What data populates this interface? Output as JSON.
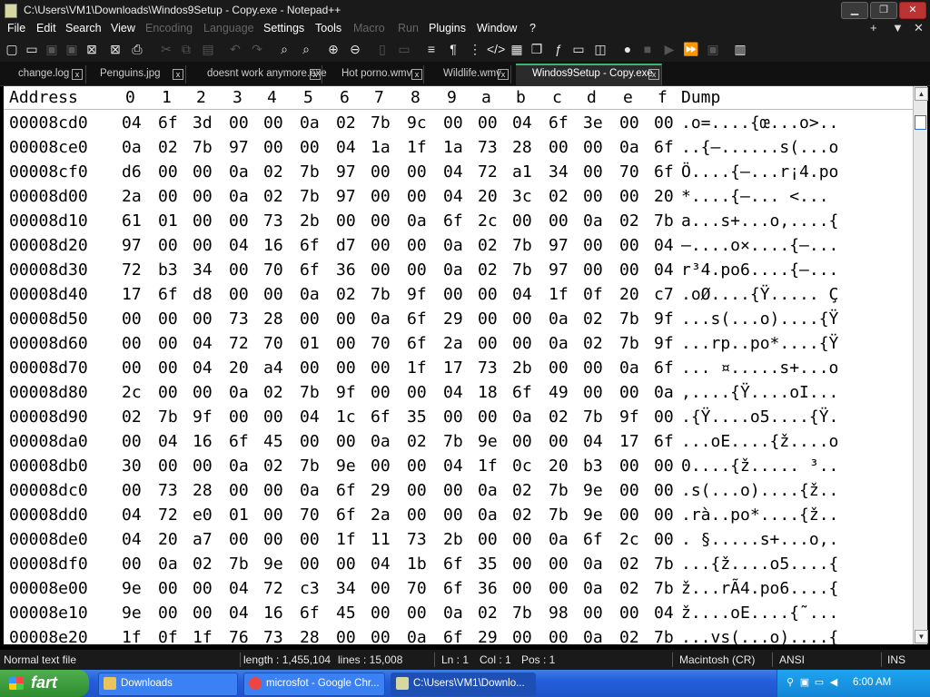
{
  "window": {
    "title": "C:\\Users\\VM1\\Downloads\\Windos9Setup - Copy.exe - Notepad++",
    "minimize": "▁",
    "maximize": "❐",
    "close": "✕"
  },
  "menu": {
    "items": [
      "File",
      "Edit",
      "Search",
      "View",
      "Encoding",
      "Language",
      "Settings",
      "Tools",
      "Macro",
      "Run",
      "Plugins",
      "Window",
      "?"
    ],
    "right_buttons": [
      "+",
      "▼",
      "✕"
    ]
  },
  "toolbar": {
    "icons": [
      "new-file-icon",
      "open-file-icon",
      "save-icon",
      "save-all-icon",
      "close-icon",
      "close-all-icon",
      "print-icon",
      "cut-icon",
      "copy-icon",
      "paste-icon",
      "undo-icon",
      "redo-icon",
      "find-icon",
      "replace-icon",
      "zoom-in-icon",
      "zoom-out-icon",
      "sync-v-icon",
      "sync-h-icon",
      "wrap-icon",
      "all-chars-icon",
      "indent-guide-icon",
      "xml-tags-icon",
      "doc-map-icon",
      "function-list-icon",
      "fx-icon",
      "monitor-icon",
      "screenshot-icon",
      "record-macro-icon",
      "stop-macro-icon",
      "play-macro-icon",
      "run-macro-multiple-icon",
      "save-macro-icon",
      "hex-editor-icon"
    ]
  },
  "tabs": [
    {
      "label": "change.log",
      "close": "x"
    },
    {
      "label": "Penguins.jpg",
      "close": "x"
    },
    {
      "label": "doesnt work anymore.exe",
      "close": "x"
    },
    {
      "label": "Hot porno.wmv",
      "close": "x"
    },
    {
      "label": "Wildlife.wmv",
      "close": "x"
    },
    {
      "label": "Windos9Setup - Copy.exe",
      "close": "x",
      "active": true
    }
  ],
  "hex_view": {
    "header": {
      "address": "Address",
      "columns": [
        "0",
        "1",
        "2",
        "3",
        "4",
        "5",
        "6",
        "7",
        "8",
        "9",
        "a",
        "b",
        "c",
        "d",
        "e",
        "f"
      ],
      "dump": "Dump"
    },
    "rows": [
      {
        "addr": "00008cd0",
        "bytes": [
          "04",
          "6f",
          "3d",
          "00",
          "00",
          "0a",
          "02",
          "7b",
          "9c",
          "00",
          "00",
          "04",
          "6f",
          "3e",
          "00",
          "00"
        ],
        "dump": ".o=....{œ...o>.."
      },
      {
        "addr": "00008ce0",
        "bytes": [
          "0a",
          "02",
          "7b",
          "97",
          "00",
          "00",
          "04",
          "1a",
          "1f",
          "1a",
          "73",
          "28",
          "00",
          "00",
          "0a",
          "6f"
        ],
        "dump": "..{—......s(...o"
      },
      {
        "addr": "00008cf0",
        "bytes": [
          "d6",
          "00",
          "00",
          "0a",
          "02",
          "7b",
          "97",
          "00",
          "00",
          "04",
          "72",
          "a1",
          "34",
          "00",
          "70",
          "6f"
        ],
        "dump": "Ö....{—...r¡4.po"
      },
      {
        "addr": "00008d00",
        "bytes": [
          "2a",
          "00",
          "00",
          "0a",
          "02",
          "7b",
          "97",
          "00",
          "00",
          "04",
          "20",
          "3c",
          "02",
          "00",
          "00",
          "20"
        ],
        "dump": "*....{—... <..."
      },
      {
        "addr": "00008d10",
        "bytes": [
          "61",
          "01",
          "00",
          "00",
          "73",
          "2b",
          "00",
          "00",
          "0a",
          "6f",
          "2c",
          "00",
          "00",
          "0a",
          "02",
          "7b"
        ],
        "dump": "a...s+...o,....{"
      },
      {
        "addr": "00008d20",
        "bytes": [
          "97",
          "00",
          "00",
          "04",
          "16",
          "6f",
          "d7",
          "00",
          "00",
          "0a",
          "02",
          "7b",
          "97",
          "00",
          "00",
          "04"
        ],
        "dump": "—....o×....{—..."
      },
      {
        "addr": "00008d30",
        "bytes": [
          "72",
          "b3",
          "34",
          "00",
          "70",
          "6f",
          "36",
          "00",
          "00",
          "0a",
          "02",
          "7b",
          "97",
          "00",
          "00",
          "04"
        ],
        "dump": "r³4.po6....{—..."
      },
      {
        "addr": "00008d40",
        "bytes": [
          "17",
          "6f",
          "d8",
          "00",
          "00",
          "0a",
          "02",
          "7b",
          "9f",
          "00",
          "00",
          "04",
          "1f",
          "0f",
          "20",
          "c7"
        ],
        "dump": ".oØ....{Ÿ..... Ç"
      },
      {
        "addr": "00008d50",
        "bytes": [
          "00",
          "00",
          "00",
          "73",
          "28",
          "00",
          "00",
          "0a",
          "6f",
          "29",
          "00",
          "00",
          "0a",
          "02",
          "7b",
          "9f"
        ],
        "dump": "...s(...o)....{Ÿ"
      },
      {
        "addr": "00008d60",
        "bytes": [
          "00",
          "00",
          "04",
          "72",
          "70",
          "01",
          "00",
          "70",
          "6f",
          "2a",
          "00",
          "00",
          "0a",
          "02",
          "7b",
          "9f"
        ],
        "dump": "...rp..po*....{Ÿ"
      },
      {
        "addr": "00008d70",
        "bytes": [
          "00",
          "00",
          "04",
          "20",
          "a4",
          "00",
          "00",
          "00",
          "1f",
          "17",
          "73",
          "2b",
          "00",
          "00",
          "0a",
          "6f"
        ],
        "dump": "... ¤.....s+...o"
      },
      {
        "addr": "00008d80",
        "bytes": [
          "2c",
          "00",
          "00",
          "0a",
          "02",
          "7b",
          "9f",
          "00",
          "00",
          "04",
          "18",
          "6f",
          "49",
          "00",
          "00",
          "0a"
        ],
        "dump": ",....{Ÿ....oI..."
      },
      {
        "addr": "00008d90",
        "bytes": [
          "02",
          "7b",
          "9f",
          "00",
          "00",
          "04",
          "1c",
          "6f",
          "35",
          "00",
          "00",
          "0a",
          "02",
          "7b",
          "9f",
          "00"
        ],
        "dump": ".{Ÿ....o5....{Ÿ."
      },
      {
        "addr": "00008da0",
        "bytes": [
          "00",
          "04",
          "16",
          "6f",
          "45",
          "00",
          "00",
          "0a",
          "02",
          "7b",
          "9e",
          "00",
          "00",
          "04",
          "17",
          "6f"
        ],
        "dump": "...oE....{ž....o"
      },
      {
        "addr": "00008db0",
        "bytes": [
          "30",
          "00",
          "00",
          "0a",
          "02",
          "7b",
          "9e",
          "00",
          "00",
          "04",
          "1f",
          "0c",
          "20",
          "b3",
          "00",
          "00"
        ],
        "dump": "0....{ž..... ³.."
      },
      {
        "addr": "00008dc0",
        "bytes": [
          "00",
          "73",
          "28",
          "00",
          "00",
          "0a",
          "6f",
          "29",
          "00",
          "00",
          "0a",
          "02",
          "7b",
          "9e",
          "00",
          "00"
        ],
        "dump": ".s(...o)....{ž.."
      },
      {
        "addr": "00008dd0",
        "bytes": [
          "04",
          "72",
          "e0",
          "01",
          "00",
          "70",
          "6f",
          "2a",
          "00",
          "00",
          "0a",
          "02",
          "7b",
          "9e",
          "00",
          "00"
        ],
        "dump": ".rà..po*....{ž.."
      },
      {
        "addr": "00008de0",
        "bytes": [
          "04",
          "20",
          "a7",
          "00",
          "00",
          "00",
          "1f",
          "11",
          "73",
          "2b",
          "00",
          "00",
          "0a",
          "6f",
          "2c",
          "00"
        ],
        "dump": ". §.....s+...o,."
      },
      {
        "addr": "00008df0",
        "bytes": [
          "00",
          "0a",
          "02",
          "7b",
          "9e",
          "00",
          "00",
          "04",
          "1b",
          "6f",
          "35",
          "00",
          "00",
          "0a",
          "02",
          "7b"
        ],
        "dump": "...{ž....o5....{"
      },
      {
        "addr": "00008e00",
        "bytes": [
          "9e",
          "00",
          "00",
          "04",
          "72",
          "c3",
          "34",
          "00",
          "70",
          "6f",
          "36",
          "00",
          "00",
          "0a",
          "02",
          "7b"
        ],
        "dump": "ž...rÃ4.po6....{"
      },
      {
        "addr": "00008e10",
        "bytes": [
          "9e",
          "00",
          "00",
          "04",
          "16",
          "6f",
          "45",
          "00",
          "00",
          "0a",
          "02",
          "7b",
          "98",
          "00",
          "00",
          "04"
        ],
        "dump": "ž....oE....{˜..."
      },
      {
        "addr": "00008e20",
        "bytes": [
          "1f",
          "0f",
          "1f",
          "76",
          "73",
          "28",
          "00",
          "00",
          "0a",
          "6f",
          "29",
          "00",
          "00",
          "0a",
          "02",
          "7b"
        ],
        "dump": "...vs(...o)....{"
      }
    ]
  },
  "status": {
    "type": "Normal text file",
    "length": "length : 1,455,104",
    "lines": "lines : 15,008",
    "ln": "Ln : 1",
    "col": "Col : 1",
    "pos": "Pos : 1",
    "eol": "Macintosh (CR)",
    "encoding": "ANSI",
    "mode": "INS"
  },
  "taskbar": {
    "start": "fart",
    "buttons": [
      {
        "label": "Downloads",
        "icon": "folder-icon",
        "color": "#e8c45a"
      },
      {
        "label": "microsfot - Google Chr...",
        "icon": "chrome-icon",
        "color": "#e44"
      },
      {
        "label": "C:\\Users\\VM1\\Downlo...",
        "icon": "notepad-icon",
        "color": "#d7d7a0",
        "active": true
      }
    ],
    "clock": "6:00 AM"
  }
}
